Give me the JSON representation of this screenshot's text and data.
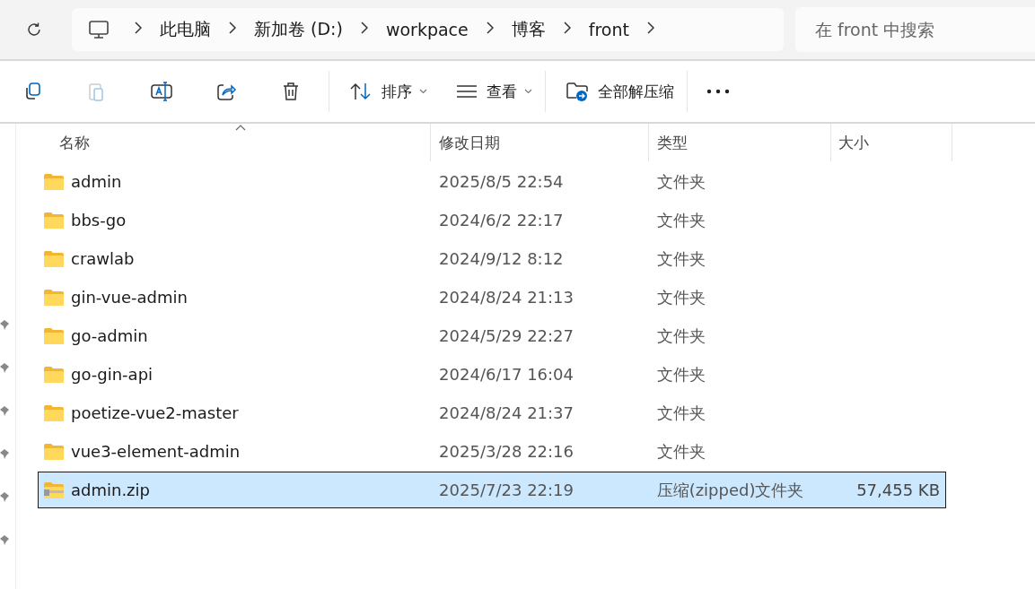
{
  "breadcrumb": [
    "此电脑",
    "新加卷 (D:)",
    "workpace",
    "博客",
    "front"
  ],
  "search": {
    "placeholder": "在 front 中搜索"
  },
  "toolbar": {
    "sort": "排序",
    "view": "查看",
    "extract_all": "全部解压缩"
  },
  "table": {
    "columns": [
      "名称",
      "修改日期",
      "类型",
      "大小"
    ],
    "rows": [
      {
        "kind": "folder",
        "name": "admin",
        "date": "2025/8/5 22:54",
        "type": "文件夹",
        "size": "",
        "selected": false
      },
      {
        "kind": "folder",
        "name": "bbs-go",
        "date": "2024/6/2 22:17",
        "type": "文件夹",
        "size": "",
        "selected": false
      },
      {
        "kind": "folder",
        "name": "crawlab",
        "date": "2024/9/12 8:12",
        "type": "文件夹",
        "size": "",
        "selected": false
      },
      {
        "kind": "folder",
        "name": "gin-vue-admin",
        "date": "2024/8/24 21:13",
        "type": "文件夹",
        "size": "",
        "selected": false
      },
      {
        "kind": "folder",
        "name": "go-admin",
        "date": "2024/5/29 22:27",
        "type": "文件夹",
        "size": "",
        "selected": false
      },
      {
        "kind": "folder",
        "name": "go-gin-api",
        "date": "2024/6/17 16:04",
        "type": "文件夹",
        "size": "",
        "selected": false
      },
      {
        "kind": "folder",
        "name": "poetize-vue2-master",
        "date": "2024/8/24 21:37",
        "type": "文件夹",
        "size": "",
        "selected": false
      },
      {
        "kind": "folder",
        "name": "vue3-element-admin",
        "date": "2025/3/28 22:16",
        "type": "文件夹",
        "size": "",
        "selected": false
      },
      {
        "kind": "zip",
        "name": "admin.zip",
        "date": "2025/7/23 22:19",
        "type": "压缩(zipped)文件夹",
        "size": "57,455 KB",
        "selected": true
      }
    ]
  }
}
